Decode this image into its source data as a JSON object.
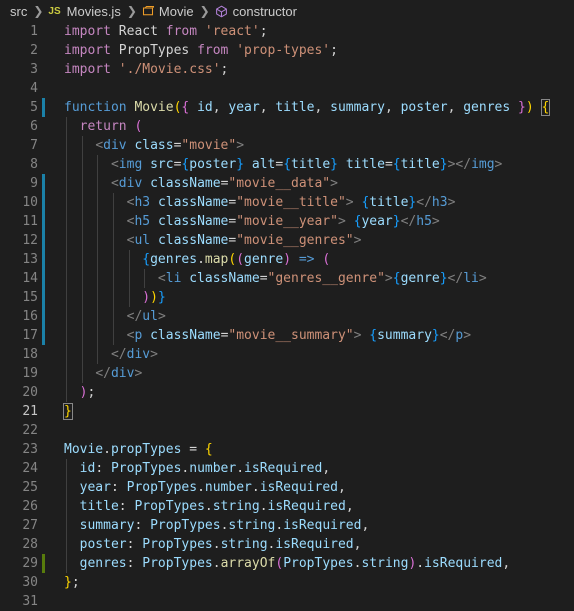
{
  "breadcrumb": {
    "folder": "src",
    "file_badge": "JS",
    "file": "Movies.js",
    "symbol": "Movie",
    "member": "constructor"
  },
  "lines": [
    {
      "n": "1",
      "mark": "",
      "tokens": [
        [
          "kc",
          "import"
        ],
        [
          "p",
          " React "
        ],
        [
          "kc",
          "from"
        ],
        [
          "p",
          " "
        ],
        [
          "s",
          "'react'"
        ],
        [
          "p",
          ";"
        ]
      ]
    },
    {
      "n": "2",
      "mark": "",
      "tokens": [
        [
          "kc",
          "import"
        ],
        [
          "p",
          " PropTypes "
        ],
        [
          "kc",
          "from"
        ],
        [
          "p",
          " "
        ],
        [
          "s",
          "'prop-types'"
        ],
        [
          "p",
          ";"
        ]
      ]
    },
    {
      "n": "3",
      "mark": "",
      "tokens": [
        [
          "kc",
          "import"
        ],
        [
          "p",
          " "
        ],
        [
          "s",
          "'./Movie.css'"
        ],
        [
          "p",
          ";"
        ]
      ]
    },
    {
      "n": "4",
      "mark": "",
      "tokens": []
    },
    {
      "n": "5",
      "mark": "blue",
      "tokens": [
        [
          "k",
          "function"
        ],
        [
          "p",
          " "
        ],
        [
          "f",
          "Movie"
        ],
        [
          "br1",
          "("
        ],
        [
          "br2",
          "{"
        ],
        [
          "v",
          " id"
        ],
        [
          "p",
          ", "
        ],
        [
          "v",
          "year"
        ],
        [
          "p",
          ", "
        ],
        [
          "v",
          "title"
        ],
        [
          "p",
          ", "
        ],
        [
          "v",
          "summary"
        ],
        [
          "p",
          ", "
        ],
        [
          "v",
          "poster"
        ],
        [
          "p",
          ", "
        ],
        [
          "v",
          "genres"
        ],
        [
          "p",
          " "
        ],
        [
          "br2",
          "}"
        ],
        [
          "br1",
          ")"
        ],
        [
          "p",
          " "
        ],
        [
          "br1box",
          "{"
        ]
      ]
    },
    {
      "n": "6",
      "mark": "",
      "tokens": [
        [
          "p",
          "  "
        ],
        [
          "kc",
          "return"
        ],
        [
          "p",
          " "
        ],
        [
          "br2",
          "("
        ]
      ]
    },
    {
      "n": "7",
      "mark": "",
      "tokens": [
        [
          "p",
          "    "
        ],
        [
          "ta",
          "<"
        ],
        [
          "t",
          "div"
        ],
        [
          "p",
          " "
        ],
        [
          "a",
          "class"
        ],
        [
          "p",
          "="
        ],
        [
          "s",
          "\"movie\""
        ],
        [
          "ta",
          ">"
        ]
      ]
    },
    {
      "n": "8",
      "mark": "",
      "tokens": [
        [
          "p",
          "      "
        ],
        [
          "ta",
          "<"
        ],
        [
          "t",
          "img"
        ],
        [
          "p",
          " "
        ],
        [
          "a",
          "src"
        ],
        [
          "p",
          "="
        ],
        [
          "br3",
          "{"
        ],
        [
          "v",
          "poster"
        ],
        [
          "br3",
          "}"
        ],
        [
          "p",
          " "
        ],
        [
          "a",
          "alt"
        ],
        [
          "p",
          "="
        ],
        [
          "br3",
          "{"
        ],
        [
          "v",
          "title"
        ],
        [
          "br3",
          "}"
        ],
        [
          "p",
          " "
        ],
        [
          "a",
          "title"
        ],
        [
          "p",
          "="
        ],
        [
          "br3",
          "{"
        ],
        [
          "v",
          "title"
        ],
        [
          "br3",
          "}"
        ],
        [
          "ta",
          "></"
        ],
        [
          "t",
          "img"
        ],
        [
          "ta",
          ">"
        ]
      ]
    },
    {
      "n": "9",
      "mark": "blue",
      "tokens": [
        [
          "p",
          "      "
        ],
        [
          "ta",
          "<"
        ],
        [
          "t",
          "div"
        ],
        [
          "p",
          " "
        ],
        [
          "a",
          "className"
        ],
        [
          "p",
          "="
        ],
        [
          "s",
          "\"movie__data\""
        ],
        [
          "ta",
          ">"
        ]
      ]
    },
    {
      "n": "10",
      "mark": "blue",
      "tokens": [
        [
          "p",
          "        "
        ],
        [
          "ta",
          "<"
        ],
        [
          "t",
          "h3"
        ],
        [
          "p",
          " "
        ],
        [
          "a",
          "className"
        ],
        [
          "p",
          "="
        ],
        [
          "s",
          "\"movie__title\""
        ],
        [
          "ta",
          ">"
        ],
        [
          "p",
          " "
        ],
        [
          "br3",
          "{"
        ],
        [
          "v",
          "title"
        ],
        [
          "br3",
          "}"
        ],
        [
          "ta",
          "</"
        ],
        [
          "t",
          "h3"
        ],
        [
          "ta",
          ">"
        ]
      ]
    },
    {
      "n": "11",
      "mark": "blue",
      "tokens": [
        [
          "p",
          "        "
        ],
        [
          "ta",
          "<"
        ],
        [
          "t",
          "h5"
        ],
        [
          "p",
          " "
        ],
        [
          "a",
          "className"
        ],
        [
          "p",
          "="
        ],
        [
          "s",
          "\"movie__year\""
        ],
        [
          "ta",
          ">"
        ],
        [
          "p",
          " "
        ],
        [
          "br3",
          "{"
        ],
        [
          "v",
          "year"
        ],
        [
          "br3",
          "}"
        ],
        [
          "ta",
          "</"
        ],
        [
          "t",
          "h5"
        ],
        [
          "ta",
          ">"
        ]
      ]
    },
    {
      "n": "12",
      "mark": "blue",
      "tokens": [
        [
          "p",
          "        "
        ],
        [
          "ta",
          "<"
        ],
        [
          "t",
          "ul"
        ],
        [
          "p",
          " "
        ],
        [
          "a",
          "className"
        ],
        [
          "p",
          "="
        ],
        [
          "s",
          "\"movie__genres\""
        ],
        [
          "ta",
          ">"
        ]
      ]
    },
    {
      "n": "13",
      "mark": "blue",
      "tokens": [
        [
          "p",
          "          "
        ],
        [
          "br3",
          "{"
        ],
        [
          "v",
          "genres"
        ],
        [
          "p",
          "."
        ],
        [
          "f",
          "map"
        ],
        [
          "br1",
          "("
        ],
        [
          "br2",
          "("
        ],
        [
          "v",
          "genre"
        ],
        [
          "br2",
          ")"
        ],
        [
          "p",
          " "
        ],
        [
          "k",
          "=>"
        ],
        [
          "p",
          " "
        ],
        [
          "br2",
          "("
        ]
      ]
    },
    {
      "n": "14",
      "mark": "blue",
      "tokens": [
        [
          "p",
          "            "
        ],
        [
          "ta",
          "<"
        ],
        [
          "t",
          "li"
        ],
        [
          "p",
          " "
        ],
        [
          "a",
          "className"
        ],
        [
          "p",
          "="
        ],
        [
          "s",
          "\"genres__genre\""
        ],
        [
          "ta",
          ">"
        ],
        [
          "br3",
          "{"
        ],
        [
          "v",
          "genre"
        ],
        [
          "br3",
          "}"
        ],
        [
          "ta",
          "</"
        ],
        [
          "t",
          "li"
        ],
        [
          "ta",
          ">"
        ]
      ]
    },
    {
      "n": "15",
      "mark": "blue",
      "tokens": [
        [
          "p",
          "          "
        ],
        [
          "br2",
          ")"
        ],
        [
          "br1",
          ")"
        ],
        [
          "br3",
          "}"
        ]
      ]
    },
    {
      "n": "16",
      "mark": "blue",
      "tokens": [
        [
          "p",
          "        "
        ],
        [
          "ta",
          "</"
        ],
        [
          "t",
          "ul"
        ],
        [
          "ta",
          ">"
        ]
      ]
    },
    {
      "n": "17",
      "mark": "blue",
      "tokens": [
        [
          "p",
          "        "
        ],
        [
          "ta",
          "<"
        ],
        [
          "t",
          "p"
        ],
        [
          "p",
          " "
        ],
        [
          "a",
          "className"
        ],
        [
          "p",
          "="
        ],
        [
          "s",
          "\"movie__summary\""
        ],
        [
          "ta",
          ">"
        ],
        [
          "p",
          " "
        ],
        [
          "br3",
          "{"
        ],
        [
          "v",
          "summary"
        ],
        [
          "br3",
          "}"
        ],
        [
          "ta",
          "</"
        ],
        [
          "t",
          "p"
        ],
        [
          "ta",
          ">"
        ]
      ]
    },
    {
      "n": "18",
      "mark": "",
      "tokens": [
        [
          "p",
          "      "
        ],
        [
          "ta",
          "</"
        ],
        [
          "t",
          "div"
        ],
        [
          "ta",
          ">"
        ]
      ]
    },
    {
      "n": "19",
      "mark": "",
      "tokens": [
        [
          "p",
          "    "
        ],
        [
          "ta",
          "</"
        ],
        [
          "t",
          "div"
        ],
        [
          "ta",
          ">"
        ]
      ]
    },
    {
      "n": "20",
      "mark": "",
      "tokens": [
        [
          "p",
          "  "
        ],
        [
          "br2",
          ")"
        ],
        [
          "p",
          ";"
        ]
      ]
    },
    {
      "n": "21",
      "mark": "",
      "active": true,
      "tokens": [
        [
          "br1box",
          "}"
        ]
      ]
    },
    {
      "n": "22",
      "mark": "",
      "tokens": []
    },
    {
      "n": "23",
      "mark": "",
      "tokens": [
        [
          "v",
          "Movie"
        ],
        [
          "p",
          "."
        ],
        [
          "v",
          "propTypes"
        ],
        [
          "p",
          " = "
        ],
        [
          "br1",
          "{"
        ]
      ]
    },
    {
      "n": "24",
      "mark": "",
      "tokens": [
        [
          "p",
          "  "
        ],
        [
          "v",
          "id"
        ],
        [
          "p",
          ": "
        ],
        [
          "v",
          "PropTypes"
        ],
        [
          "p",
          "."
        ],
        [
          "v",
          "number"
        ],
        [
          "p",
          "."
        ],
        [
          "v",
          "isRequired"
        ],
        [
          "p",
          ","
        ]
      ]
    },
    {
      "n": "25",
      "mark": "",
      "tokens": [
        [
          "p",
          "  "
        ],
        [
          "v",
          "year"
        ],
        [
          "p",
          ": "
        ],
        [
          "v",
          "PropTypes"
        ],
        [
          "p",
          "."
        ],
        [
          "v",
          "number"
        ],
        [
          "p",
          "."
        ],
        [
          "v",
          "isRequired"
        ],
        [
          "p",
          ","
        ]
      ]
    },
    {
      "n": "26",
      "mark": "",
      "tokens": [
        [
          "p",
          "  "
        ],
        [
          "v",
          "title"
        ],
        [
          "p",
          ": "
        ],
        [
          "v",
          "PropTypes"
        ],
        [
          "p",
          "."
        ],
        [
          "v",
          "string"
        ],
        [
          "p",
          "."
        ],
        [
          "v",
          "isRequired"
        ],
        [
          "p",
          ","
        ]
      ]
    },
    {
      "n": "27",
      "mark": "",
      "tokens": [
        [
          "p",
          "  "
        ],
        [
          "v",
          "summary"
        ],
        [
          "p",
          ": "
        ],
        [
          "v",
          "PropTypes"
        ],
        [
          "p",
          "."
        ],
        [
          "v",
          "string"
        ],
        [
          "p",
          "."
        ],
        [
          "v",
          "isRequired"
        ],
        [
          "p",
          ","
        ]
      ]
    },
    {
      "n": "28",
      "mark": "",
      "tokens": [
        [
          "p",
          "  "
        ],
        [
          "v",
          "poster"
        ],
        [
          "p",
          ": "
        ],
        [
          "v",
          "PropTypes"
        ],
        [
          "p",
          "."
        ],
        [
          "v",
          "string"
        ],
        [
          "p",
          "."
        ],
        [
          "v",
          "isRequired"
        ],
        [
          "p",
          ","
        ]
      ]
    },
    {
      "n": "29",
      "mark": "green",
      "tokens": [
        [
          "p",
          "  "
        ],
        [
          "v",
          "genres"
        ],
        [
          "p",
          ": "
        ],
        [
          "v",
          "PropTypes"
        ],
        [
          "p",
          "."
        ],
        [
          "f",
          "arrayOf"
        ],
        [
          "br2",
          "("
        ],
        [
          "v",
          "PropTypes"
        ],
        [
          "p",
          "."
        ],
        [
          "v",
          "string"
        ],
        [
          "br2",
          ")"
        ],
        [
          "p",
          "."
        ],
        [
          "v",
          "isRequired"
        ],
        [
          "p",
          ","
        ]
      ]
    },
    {
      "n": "30",
      "mark": "",
      "tokens": [
        [
          "br1",
          "}"
        ],
        [
          "p",
          ";"
        ]
      ]
    },
    {
      "n": "31",
      "mark": "",
      "tokens": []
    }
  ]
}
